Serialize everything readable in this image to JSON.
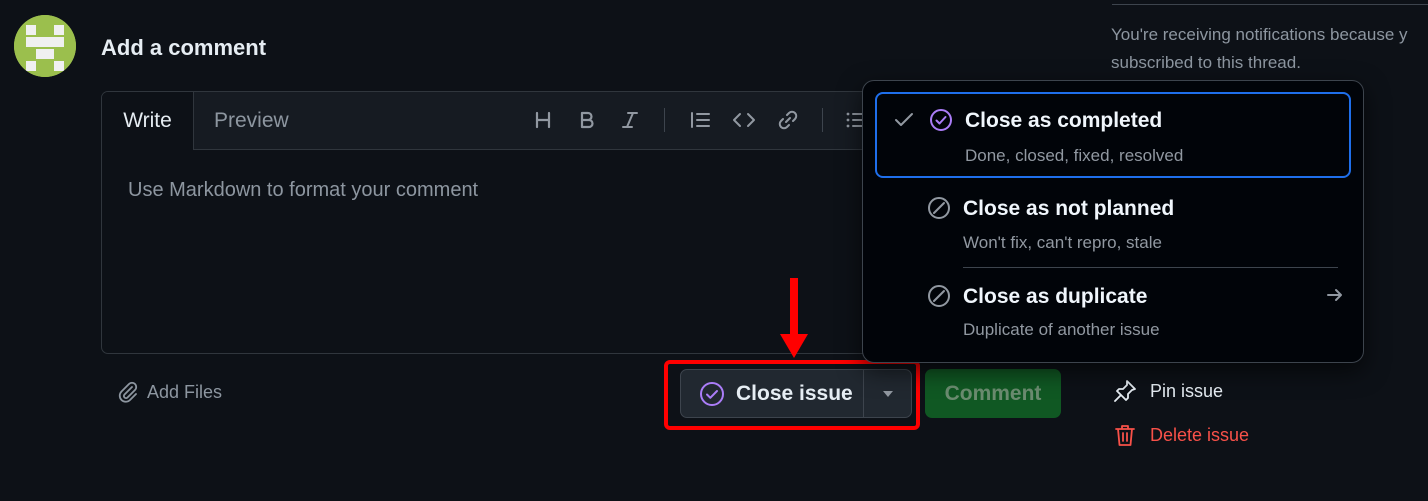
{
  "comment": {
    "heading": "Add a comment",
    "tabs": {
      "write": "Write",
      "preview": "Preview"
    },
    "placeholder": "Use Markdown to format your comment",
    "add_files": "Add Files"
  },
  "toolbar": [
    "heading-icon",
    "bold-icon",
    "italic-icon",
    "quote-icon",
    "code-icon",
    "link-icon",
    "unordered-list-icon"
  ],
  "actions": {
    "close_issue": "Close issue",
    "comment": "Comment"
  },
  "close_menu": {
    "items": [
      {
        "title": "Close as completed",
        "description": "Done, closed, fixed, resolved",
        "selected": true,
        "icon": "check-circle-icon"
      },
      {
        "title": "Close as not planned",
        "description": "Won't fix, can't repro, stale",
        "selected": false,
        "icon": "skip-icon"
      },
      {
        "title": "Close as duplicate",
        "description": "Duplicate of another issue",
        "selected": false,
        "icon": "skip-icon",
        "has_submenu": true
      }
    ]
  },
  "sidebar": {
    "notification": "You're receiving notifications because y\nsubscribed to this thread.",
    "pin_issue": "Pin issue",
    "delete_issue": "Delete issue"
  },
  "colors": {
    "background": "#0d1117",
    "accent_purple": "#ab7df8",
    "focus_blue": "#1f6feb",
    "danger": "#f85149",
    "highlight_red": "#ff0000"
  }
}
